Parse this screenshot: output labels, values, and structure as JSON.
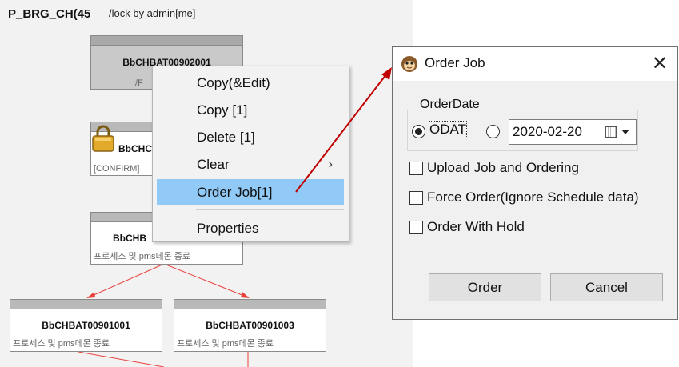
{
  "canvas": {
    "title": "P_BRG_CH(45",
    "lock_text": "/lock by admin[me]",
    "nodes": [
      {
        "name": "BbCHBAT00902001",
        "desc": "I/F"
      },
      {
        "name": "BbCHCI",
        "desc": "[CONFIRM]"
      },
      {
        "name": "BbCHB",
        "desc": "프로세스 및 pms데몬 종료"
      },
      {
        "name": "BbCHBAT00901001",
        "desc": "프로세스 및 pms데몬 종료"
      },
      {
        "name": "BbCHBAT00901003",
        "desc": "프로세스 및 pms데몬 종료"
      }
    ]
  },
  "context_menu": {
    "items": [
      {
        "label": "Copy(&Edit)"
      },
      {
        "label": "Copy [1]"
      },
      {
        "label": "Delete [1]"
      },
      {
        "label": "Clear",
        "submenu_arrow": "›"
      },
      {
        "label": "Order Job[1]",
        "highlighted": true
      },
      {
        "label": "Properties"
      }
    ]
  },
  "dialog": {
    "title": "Order Job",
    "close_glyph": "✕",
    "order_date_label": "OrderDate",
    "radio_odat_label": "ODAT",
    "radio_odat_selected": true,
    "date_value": "2020-02-20",
    "checkboxes": [
      {
        "label": "Upload Job and Ordering",
        "checked": false
      },
      {
        "label": "Force Order(Ignore Schedule data)",
        "checked": false
      },
      {
        "label": "Order With Hold",
        "checked": false
      }
    ],
    "order_button": "Order",
    "cancel_button": "Cancel"
  },
  "colors": {
    "highlight": "#91c9f7",
    "arrow_red": "#c00000",
    "link_red": "#e8413c"
  },
  "icons": {
    "lock": "padlock-icon",
    "dialog": "app-monkey-icon",
    "calendar": "calendar-icon"
  }
}
